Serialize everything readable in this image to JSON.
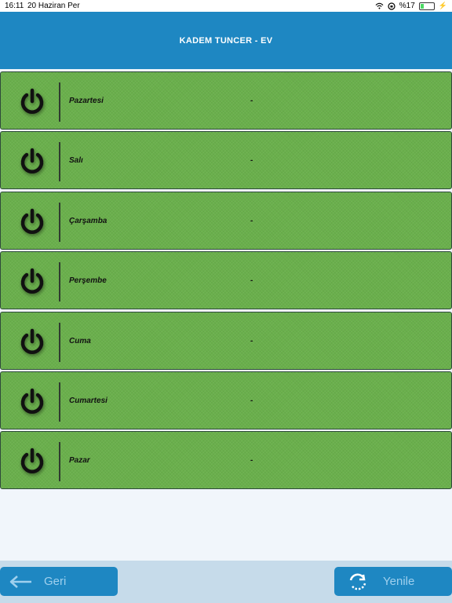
{
  "status_bar": {
    "time": "16:11",
    "date": "20 Haziran Per",
    "battery": "%17"
  },
  "header": {
    "title": "KADEM TUNCER - EV"
  },
  "schedule": [
    {
      "day": "Pazartesi",
      "value": "-"
    },
    {
      "day": "Salı",
      "value": "-"
    },
    {
      "day": "Çarşamba",
      "value": "-"
    },
    {
      "day": "Perşembe",
      "value": "-"
    },
    {
      "day": "Cuma",
      "value": "-"
    },
    {
      "day": "Cumartesi",
      "value": "-"
    },
    {
      "day": "Pazar",
      "value": "-"
    }
  ],
  "footer": {
    "back_label": "Geri",
    "refresh_label": "Yenile"
  },
  "colors": {
    "header_bg": "#1e87c2",
    "row_bg": "#6ab04c",
    "button_bg": "#1e87c2",
    "button_text": "#9fd0ee",
    "footer_bg": "#c6dbea"
  },
  "icons": {
    "row": "power-icon",
    "back": "arrow-left-icon",
    "refresh": "refresh-icon"
  }
}
